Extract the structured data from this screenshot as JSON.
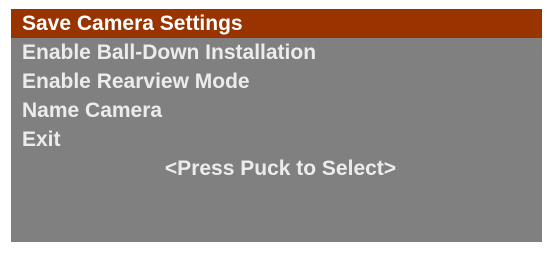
{
  "menu": {
    "items": [
      {
        "label": "Save Camera Settings",
        "selected": true
      },
      {
        "label": "Enable Ball-Down Installation",
        "selected": false
      },
      {
        "label": "Enable Rearview Mode",
        "selected": false
      },
      {
        "label": "Name Camera",
        "selected": false
      },
      {
        "label": "Exit",
        "selected": false
      }
    ],
    "hint": "<Press Puck to Select>"
  },
  "colors": {
    "panel_background": "#808080",
    "selected_background": "#993300",
    "text": "#ececec",
    "selected_text": "#ffffff"
  }
}
